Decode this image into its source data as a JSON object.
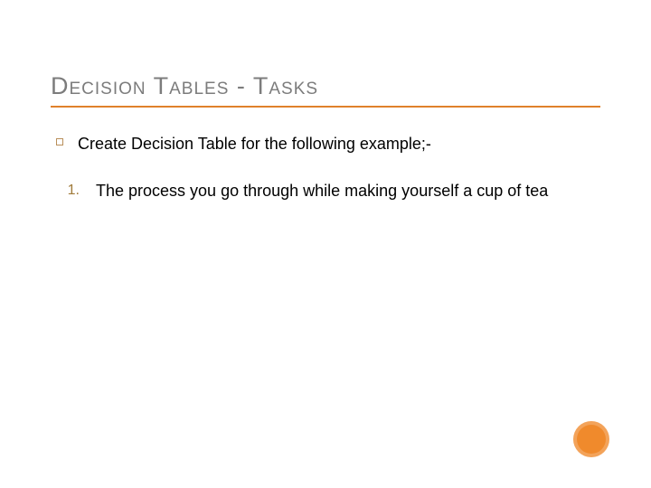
{
  "title": "Decision Tables - Tasks",
  "bullets": [
    {
      "text": "Create Decision Table for the following example;-"
    }
  ],
  "numbered": [
    {
      "marker": "1.",
      "text": "The process you go through while making yourself a cup of tea"
    }
  ],
  "accent_color": "#f08a2c"
}
